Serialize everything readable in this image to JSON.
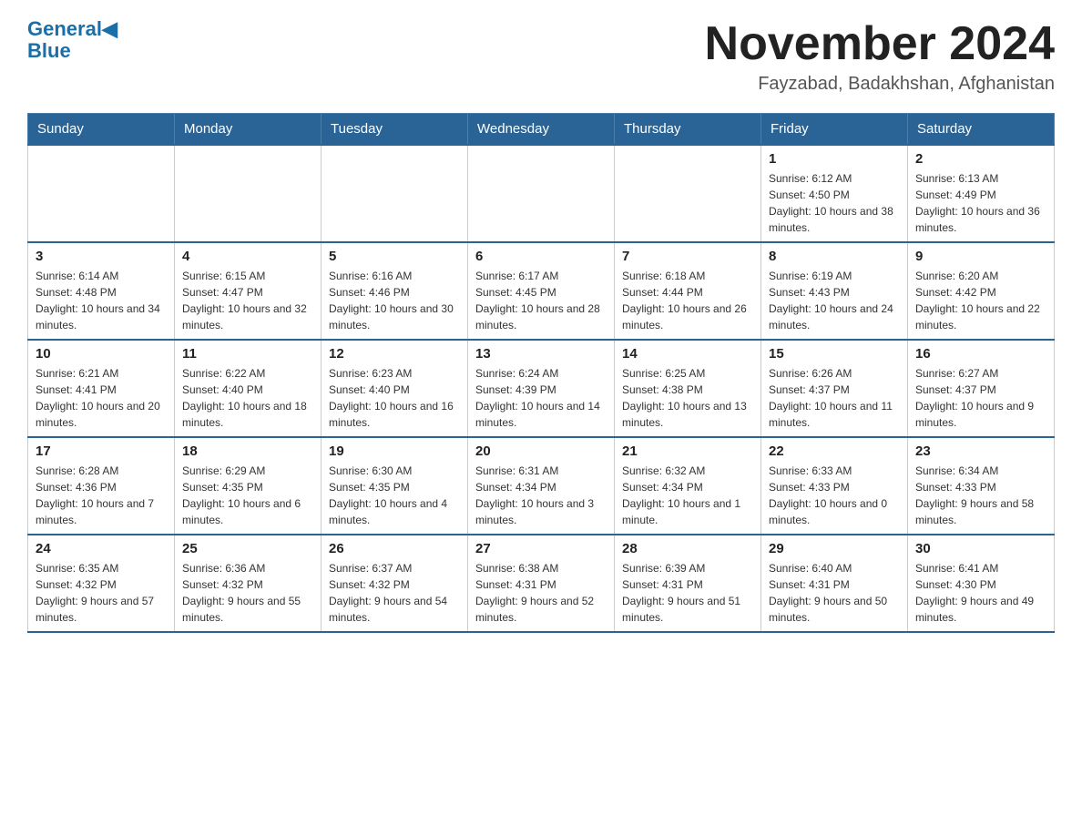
{
  "logo": {
    "general": "General",
    "blue": "Blue"
  },
  "header": {
    "title": "November 2024",
    "subtitle": "Fayzabad, Badakhshan, Afghanistan"
  },
  "days_of_week": [
    "Sunday",
    "Monday",
    "Tuesday",
    "Wednesday",
    "Thursday",
    "Friday",
    "Saturday"
  ],
  "weeks": [
    [
      {
        "day": "",
        "info": ""
      },
      {
        "day": "",
        "info": ""
      },
      {
        "day": "",
        "info": ""
      },
      {
        "day": "",
        "info": ""
      },
      {
        "day": "",
        "info": ""
      },
      {
        "day": "1",
        "info": "Sunrise: 6:12 AM\nSunset: 4:50 PM\nDaylight: 10 hours and 38 minutes."
      },
      {
        "day": "2",
        "info": "Sunrise: 6:13 AM\nSunset: 4:49 PM\nDaylight: 10 hours and 36 minutes."
      }
    ],
    [
      {
        "day": "3",
        "info": "Sunrise: 6:14 AM\nSunset: 4:48 PM\nDaylight: 10 hours and 34 minutes."
      },
      {
        "day": "4",
        "info": "Sunrise: 6:15 AM\nSunset: 4:47 PM\nDaylight: 10 hours and 32 minutes."
      },
      {
        "day": "5",
        "info": "Sunrise: 6:16 AM\nSunset: 4:46 PM\nDaylight: 10 hours and 30 minutes."
      },
      {
        "day": "6",
        "info": "Sunrise: 6:17 AM\nSunset: 4:45 PM\nDaylight: 10 hours and 28 minutes."
      },
      {
        "day": "7",
        "info": "Sunrise: 6:18 AM\nSunset: 4:44 PM\nDaylight: 10 hours and 26 minutes."
      },
      {
        "day": "8",
        "info": "Sunrise: 6:19 AM\nSunset: 4:43 PM\nDaylight: 10 hours and 24 minutes."
      },
      {
        "day": "9",
        "info": "Sunrise: 6:20 AM\nSunset: 4:42 PM\nDaylight: 10 hours and 22 minutes."
      }
    ],
    [
      {
        "day": "10",
        "info": "Sunrise: 6:21 AM\nSunset: 4:41 PM\nDaylight: 10 hours and 20 minutes."
      },
      {
        "day": "11",
        "info": "Sunrise: 6:22 AM\nSunset: 4:40 PM\nDaylight: 10 hours and 18 minutes."
      },
      {
        "day": "12",
        "info": "Sunrise: 6:23 AM\nSunset: 4:40 PM\nDaylight: 10 hours and 16 minutes."
      },
      {
        "day": "13",
        "info": "Sunrise: 6:24 AM\nSunset: 4:39 PM\nDaylight: 10 hours and 14 minutes."
      },
      {
        "day": "14",
        "info": "Sunrise: 6:25 AM\nSunset: 4:38 PM\nDaylight: 10 hours and 13 minutes."
      },
      {
        "day": "15",
        "info": "Sunrise: 6:26 AM\nSunset: 4:37 PM\nDaylight: 10 hours and 11 minutes."
      },
      {
        "day": "16",
        "info": "Sunrise: 6:27 AM\nSunset: 4:37 PM\nDaylight: 10 hours and 9 minutes."
      }
    ],
    [
      {
        "day": "17",
        "info": "Sunrise: 6:28 AM\nSunset: 4:36 PM\nDaylight: 10 hours and 7 minutes."
      },
      {
        "day": "18",
        "info": "Sunrise: 6:29 AM\nSunset: 4:35 PM\nDaylight: 10 hours and 6 minutes."
      },
      {
        "day": "19",
        "info": "Sunrise: 6:30 AM\nSunset: 4:35 PM\nDaylight: 10 hours and 4 minutes."
      },
      {
        "day": "20",
        "info": "Sunrise: 6:31 AM\nSunset: 4:34 PM\nDaylight: 10 hours and 3 minutes."
      },
      {
        "day": "21",
        "info": "Sunrise: 6:32 AM\nSunset: 4:34 PM\nDaylight: 10 hours and 1 minute."
      },
      {
        "day": "22",
        "info": "Sunrise: 6:33 AM\nSunset: 4:33 PM\nDaylight: 10 hours and 0 minutes."
      },
      {
        "day": "23",
        "info": "Sunrise: 6:34 AM\nSunset: 4:33 PM\nDaylight: 9 hours and 58 minutes."
      }
    ],
    [
      {
        "day": "24",
        "info": "Sunrise: 6:35 AM\nSunset: 4:32 PM\nDaylight: 9 hours and 57 minutes."
      },
      {
        "day": "25",
        "info": "Sunrise: 6:36 AM\nSunset: 4:32 PM\nDaylight: 9 hours and 55 minutes."
      },
      {
        "day": "26",
        "info": "Sunrise: 6:37 AM\nSunset: 4:32 PM\nDaylight: 9 hours and 54 minutes."
      },
      {
        "day": "27",
        "info": "Sunrise: 6:38 AM\nSunset: 4:31 PM\nDaylight: 9 hours and 52 minutes."
      },
      {
        "day": "28",
        "info": "Sunrise: 6:39 AM\nSunset: 4:31 PM\nDaylight: 9 hours and 51 minutes."
      },
      {
        "day": "29",
        "info": "Sunrise: 6:40 AM\nSunset: 4:31 PM\nDaylight: 9 hours and 50 minutes."
      },
      {
        "day": "30",
        "info": "Sunrise: 6:41 AM\nSunset: 4:30 PM\nDaylight: 9 hours and 49 minutes."
      }
    ]
  ]
}
